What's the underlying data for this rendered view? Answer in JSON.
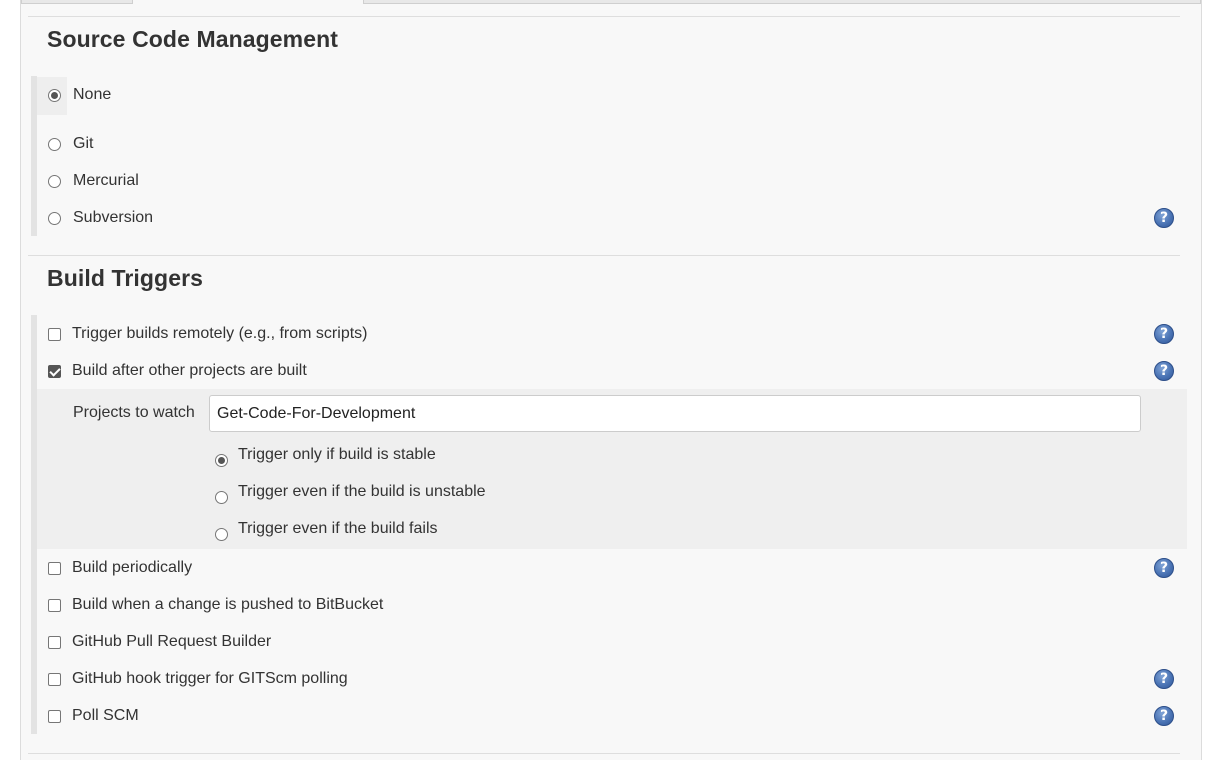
{
  "scm": {
    "title": "Source Code Management",
    "options": [
      {
        "label": "None",
        "selected": true
      },
      {
        "label": "Git",
        "selected": false
      },
      {
        "label": "Mercurial",
        "selected": false
      },
      {
        "label": "Subversion",
        "selected": false
      }
    ]
  },
  "triggers": {
    "title": "Build Triggers",
    "items": [
      {
        "label": "Trigger builds remotely (e.g., from scripts)",
        "checked": false
      },
      {
        "label": "Build after other projects are built",
        "checked": true
      },
      {
        "label": "Build periodically",
        "checked": false
      },
      {
        "label": "Build when a change is pushed to BitBucket",
        "checked": false
      },
      {
        "label": "GitHub Pull Request Builder",
        "checked": false
      },
      {
        "label": "GitHub hook trigger for GITScm polling",
        "checked": false
      },
      {
        "label": "Poll SCM",
        "checked": false
      }
    ],
    "build_after": {
      "projects_label": "Projects to watch",
      "projects_value": "Get-Code-For-Development",
      "options": [
        {
          "label": "Trigger only if build is stable",
          "selected": true
        },
        {
          "label": "Trigger even if the build is unstable",
          "selected": false
        },
        {
          "label": "Trigger even if the build fails",
          "selected": false
        }
      ]
    }
  },
  "help_icon": {
    "glyph": "?",
    "color": "#4b74b5"
  },
  "icons": [
    "help-icon"
  ]
}
